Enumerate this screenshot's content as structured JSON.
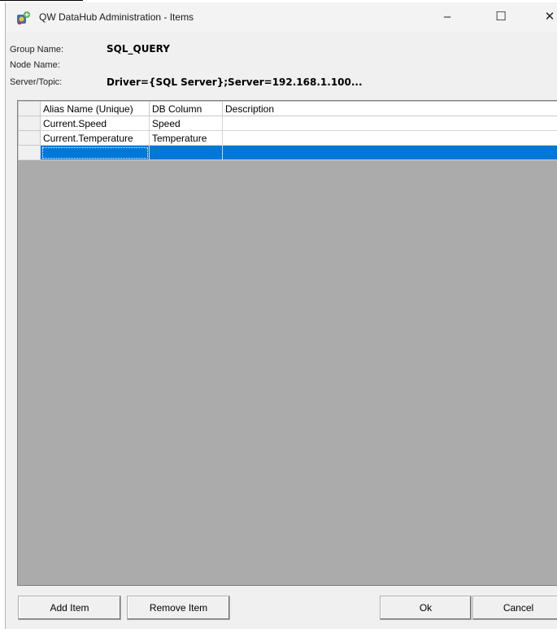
{
  "window": {
    "title": "QW DataHub Administration - Items",
    "minimize_glyph": "–",
    "maximize_glyph": "☐",
    "close_glyph": "✕",
    "icon": "datahub-app-icon"
  },
  "info": {
    "group_label": "Group Name:",
    "group_value": "SQL_QUERY",
    "node_label": "Node Name:",
    "node_value": "",
    "server_label": "Server/Topic:",
    "server_value": "Driver={SQL Server};Server=192.168.1.100..."
  },
  "table": {
    "columns": [
      "Alias Name (Unique)",
      "DB Column",
      "Description"
    ],
    "rows": [
      {
        "alias": "Current.Speed",
        "db_column": "Speed",
        "description": ""
      },
      {
        "alias": "Current.Temperature",
        "db_column": "Temperature",
        "description": ""
      },
      {
        "alias": "",
        "db_column": "",
        "description": ""
      }
    ],
    "selected_row_color": "#0078d7",
    "empty_area_color": "#ababab"
  },
  "buttons": {
    "add_item": "Add Item",
    "remove_item": "Remove Item",
    "ok": "Ok",
    "cancel": "Cancel"
  }
}
